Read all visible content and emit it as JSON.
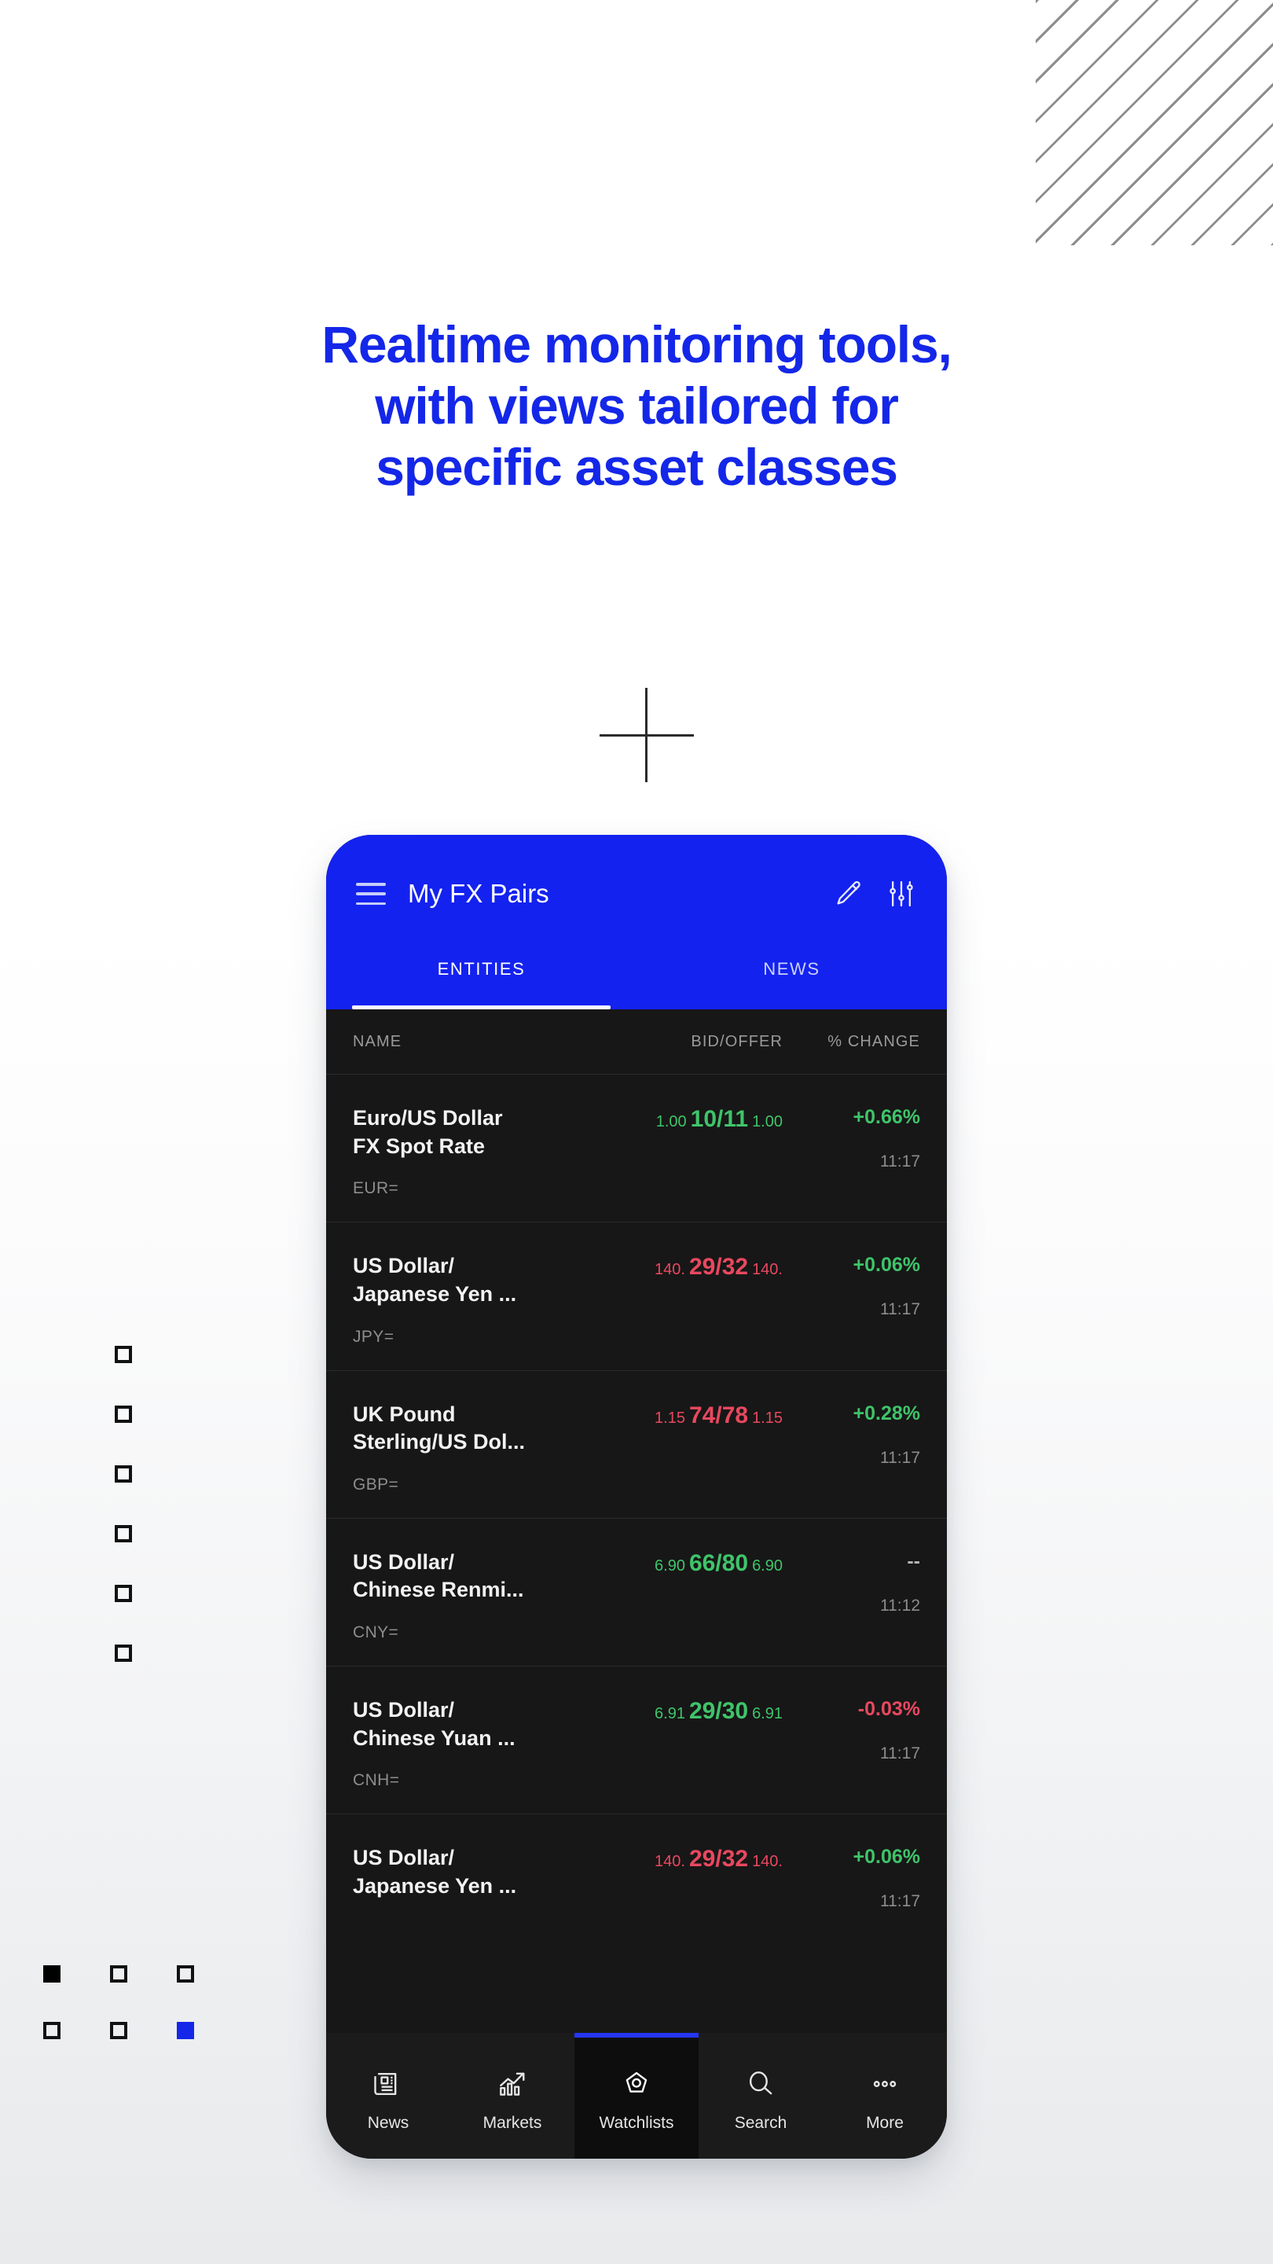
{
  "headline": {
    "lines": [
      "Realtime monitoring tools,",
      "with views tailored for",
      "specific asset classes"
    ],
    "color": "#1427e8"
  },
  "decor": {
    "stripes_name": "diagonal-stripes-pattern",
    "stripe_color": "#8d8d8d",
    "plus_name": "plus-crosshair-mark",
    "plus_color": "#2b2b2b",
    "square_outline_color": "#121212",
    "square_black": "#000000",
    "square_blue": "#1427e8",
    "column_squares": [
      {
        "name": "square-col-1",
        "fill": "none"
      },
      {
        "name": "square-col-2",
        "fill": "none"
      },
      {
        "name": "square-col-3",
        "fill": "none"
      },
      {
        "name": "square-col-4",
        "fill": "none"
      },
      {
        "name": "square-col-5",
        "fill": "none"
      },
      {
        "name": "square-col-6",
        "fill": "none"
      }
    ],
    "grid_squares": [
      {
        "name": "square-grid-r1c1",
        "fill": "black"
      },
      {
        "name": "square-grid-r1c2",
        "fill": "none"
      },
      {
        "name": "square-grid-r1c3",
        "fill": "none"
      },
      {
        "name": "square-grid-r2c1",
        "fill": "none"
      },
      {
        "name": "square-grid-r2c2",
        "fill": "none"
      },
      {
        "name": "square-grid-r2c3",
        "fill": "blue"
      }
    ]
  },
  "phone": {
    "app_bar": {
      "title": "My FX Pairs",
      "accent": "#1422ef",
      "menu_icon": "hamburger-icon",
      "edit_icon": "pencil-icon",
      "settings_icon": "sliders-icon"
    },
    "tabs": [
      {
        "label": "ENTITIES",
        "active": true
      },
      {
        "label": "NEWS",
        "active": false
      }
    ],
    "columns": {
      "name": "NAME",
      "bid_offer": "BID/OFFER",
      "change": "% CHANGE"
    },
    "rows": [
      {
        "name": "Euro/US Dollar\nFX Spot Rate",
        "ric": "EUR=",
        "bid_prefix": "1.00",
        "bid_main": "10/11",
        "bid_suffix": "1.00",
        "bid_dir": "up",
        "change": "+0.66%",
        "change_dir": "up",
        "time": "11:17"
      },
      {
        "name": "US Dollar/\nJapanese Yen ...",
        "ric": "JPY=",
        "bid_prefix": "140.",
        "bid_main": "29/32",
        "bid_suffix": "140.",
        "bid_dir": "down",
        "change": "+0.06%",
        "change_dir": "up",
        "time": "11:17"
      },
      {
        "name": "UK Pound\nSterling/US Dol...",
        "ric": "GBP=",
        "bid_prefix": "1.15",
        "bid_main": "74/78",
        "bid_suffix": "1.15",
        "bid_dir": "down",
        "change": "+0.28%",
        "change_dir": "up",
        "time": "11:17"
      },
      {
        "name": "US Dollar/\nChinese Renmi...",
        "ric": "CNY=",
        "bid_prefix": "6.90",
        "bid_main": "66/80",
        "bid_suffix": "6.90",
        "bid_dir": "up",
        "change": "--",
        "change_dir": "flat",
        "time": "11:12"
      },
      {
        "name": "US Dollar/\nChinese Yuan ...",
        "ric": "CNH=",
        "bid_prefix": "6.91",
        "bid_main": "29/30",
        "bid_suffix": "6.91",
        "bid_dir": "up",
        "change": "-0.03%",
        "change_dir": "down",
        "time": "11:17"
      },
      {
        "name": "US Dollar/\nJapanese Yen ...",
        "ric": "",
        "bid_prefix": "140.",
        "bid_main": "29/32",
        "bid_suffix": "140.",
        "bid_dir": "down",
        "change": "+0.06%",
        "change_dir": "up",
        "time": "11:17"
      }
    ],
    "bottom_nav": [
      {
        "label": "News",
        "icon": "newspaper-icon",
        "active": false
      },
      {
        "label": "Markets",
        "icon": "chart-trend-icon",
        "active": false
      },
      {
        "label": "Watchlists",
        "icon": "eye-icon",
        "active": true
      },
      {
        "label": "Search",
        "icon": "search-icon",
        "active": false
      },
      {
        "label": "More",
        "icon": "more-dots-icon",
        "active": false
      }
    ],
    "colors": {
      "up": "#3fc46a",
      "down": "#e8485f",
      "flat": "#b4b4b4",
      "screen_bg": "#171717",
      "nav_bg": "#1b1b1b",
      "nav_active_bar": "#2536f2"
    }
  }
}
